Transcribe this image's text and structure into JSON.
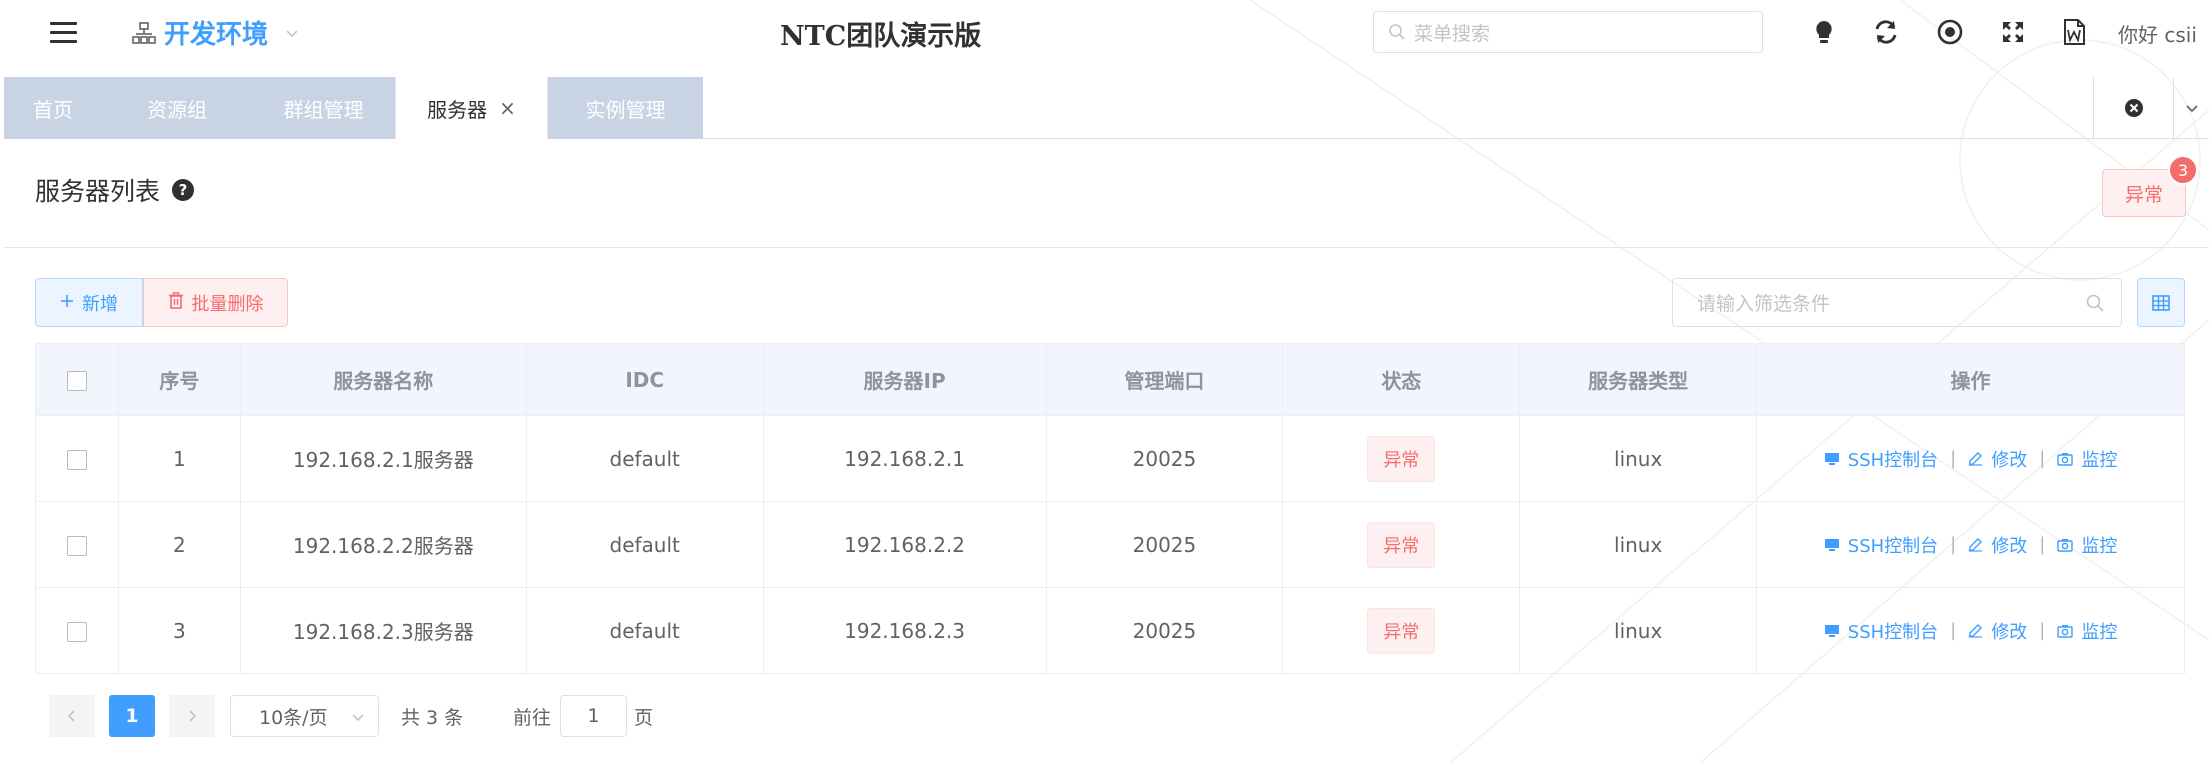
{
  "header": {
    "env_label": "开发环境",
    "app_title": "NTC团队演示版",
    "search_placeholder": "菜单搜索",
    "greeting": "你好 csii"
  },
  "tabs": [
    {
      "label": "首页",
      "active": false
    },
    {
      "label": "资源组",
      "active": false
    },
    {
      "label": "群组管理",
      "active": false
    },
    {
      "label": "服务器",
      "active": true,
      "close": "×"
    },
    {
      "label": "实例管理",
      "active": false
    }
  ],
  "page": {
    "title": "服务器列表",
    "help": "?",
    "abnormal_button": "异常",
    "abnormal_count": "3"
  },
  "toolbar": {
    "add_label": "新增",
    "batch_delete_label": "批量删除",
    "filter_placeholder": "请输入筛选条件"
  },
  "table": {
    "headers": [
      "序号",
      "服务器名称",
      "IDC",
      "服务器IP",
      "管理端口",
      "状态",
      "服务器类型",
      "操作"
    ],
    "rows": [
      {
        "index": "1",
        "name": "192.168.2.1服务器",
        "idc": "default",
        "ip": "192.168.2.1",
        "port": "20025",
        "status": "异常",
        "type": "linux"
      },
      {
        "index": "2",
        "name": "192.168.2.2服务器",
        "idc": "default",
        "ip": "192.168.2.2",
        "port": "20025",
        "status": "异常",
        "type": "linux"
      },
      {
        "index": "3",
        "name": "192.168.2.3服务器",
        "idc": "default",
        "ip": "192.168.2.3",
        "port": "20025",
        "status": "异常",
        "type": "linux"
      }
    ],
    "actions": {
      "ssh": "SSH控制台",
      "edit": "修改",
      "monitor": "监控",
      "separator": "|"
    }
  },
  "pagination": {
    "current_page": "1",
    "page_size": "10条/页",
    "total": "共 3 条",
    "goto_label": "前往",
    "goto_value": "1",
    "page_suffix": "页"
  },
  "colors": {
    "primary": "#409eff",
    "danger": "#f56c6c",
    "tab_inactive": "#c8d3e4"
  }
}
